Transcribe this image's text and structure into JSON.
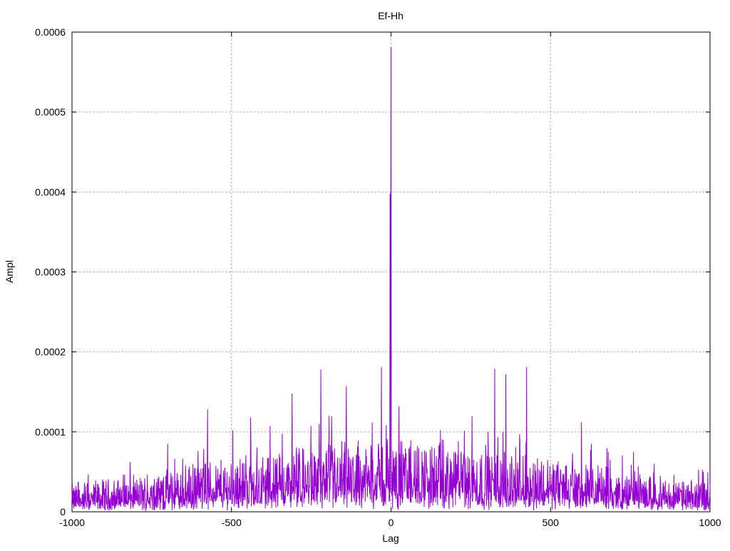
{
  "chart_data": {
    "type": "line",
    "title": "Ef-Hh",
    "xlabel": "Lag",
    "ylabel": "Ampl",
    "xlim": [
      -1000,
      1000
    ],
    "ylim": [
      0,
      0.0006
    ],
    "xticks": [
      -1000,
      -500,
      0,
      500,
      1000
    ],
    "xtick_labels": [
      "-1000",
      "-500",
      "0",
      "500",
      "1000"
    ],
    "yticks": [
      0,
      0.0001,
      0.0002,
      0.0003,
      0.0004,
      0.0005,
      0.0006
    ],
    "ytick_labels": [
      "0",
      "0.0001",
      "0.0002",
      "0.0003",
      "0.0004",
      "0.0005",
      "0.0006"
    ],
    "grid": true,
    "series": [
      {
        "color": "#9400d3",
        "lag_step": 1,
        "baseline_envelope": {
          "x": [
            -1000,
            -750,
            -500,
            -250,
            0,
            250,
            500,
            750,
            1000
          ],
          "mean": [
            1.5e-05,
            2e-05,
            3e-05,
            3.5e-05,
            4e-05,
            3.5e-05,
            3e-05,
            2e-05,
            1.5e-05
          ]
        },
        "peaks": [
          {
            "x": -3,
            "y": 0.000398
          },
          {
            "x": -1,
            "y": 0.00033
          },
          {
            "x": 0,
            "y": 0.000581
          },
          {
            "x": -575,
            "y": 0.000128
          },
          {
            "x": -440,
            "y": 0.000118
          },
          {
            "x": -310,
            "y": 0.000148
          },
          {
            "x": -220,
            "y": 0.000178
          },
          {
            "x": -140,
            "y": 0.000157
          },
          {
            "x": -30,
            "y": 0.000181
          },
          {
            "x": 25,
            "y": 0.000132
          },
          {
            "x": 325,
            "y": 0.000179
          },
          {
            "x": 360,
            "y": 0.000172
          },
          {
            "x": 425,
            "y": 0.000181
          },
          {
            "x": 597,
            "y": 0.000112
          },
          {
            "x": -700,
            "y": 8.5e-05
          },
          {
            "x": 760,
            "y": 7.5e-05
          }
        ]
      }
    ]
  }
}
